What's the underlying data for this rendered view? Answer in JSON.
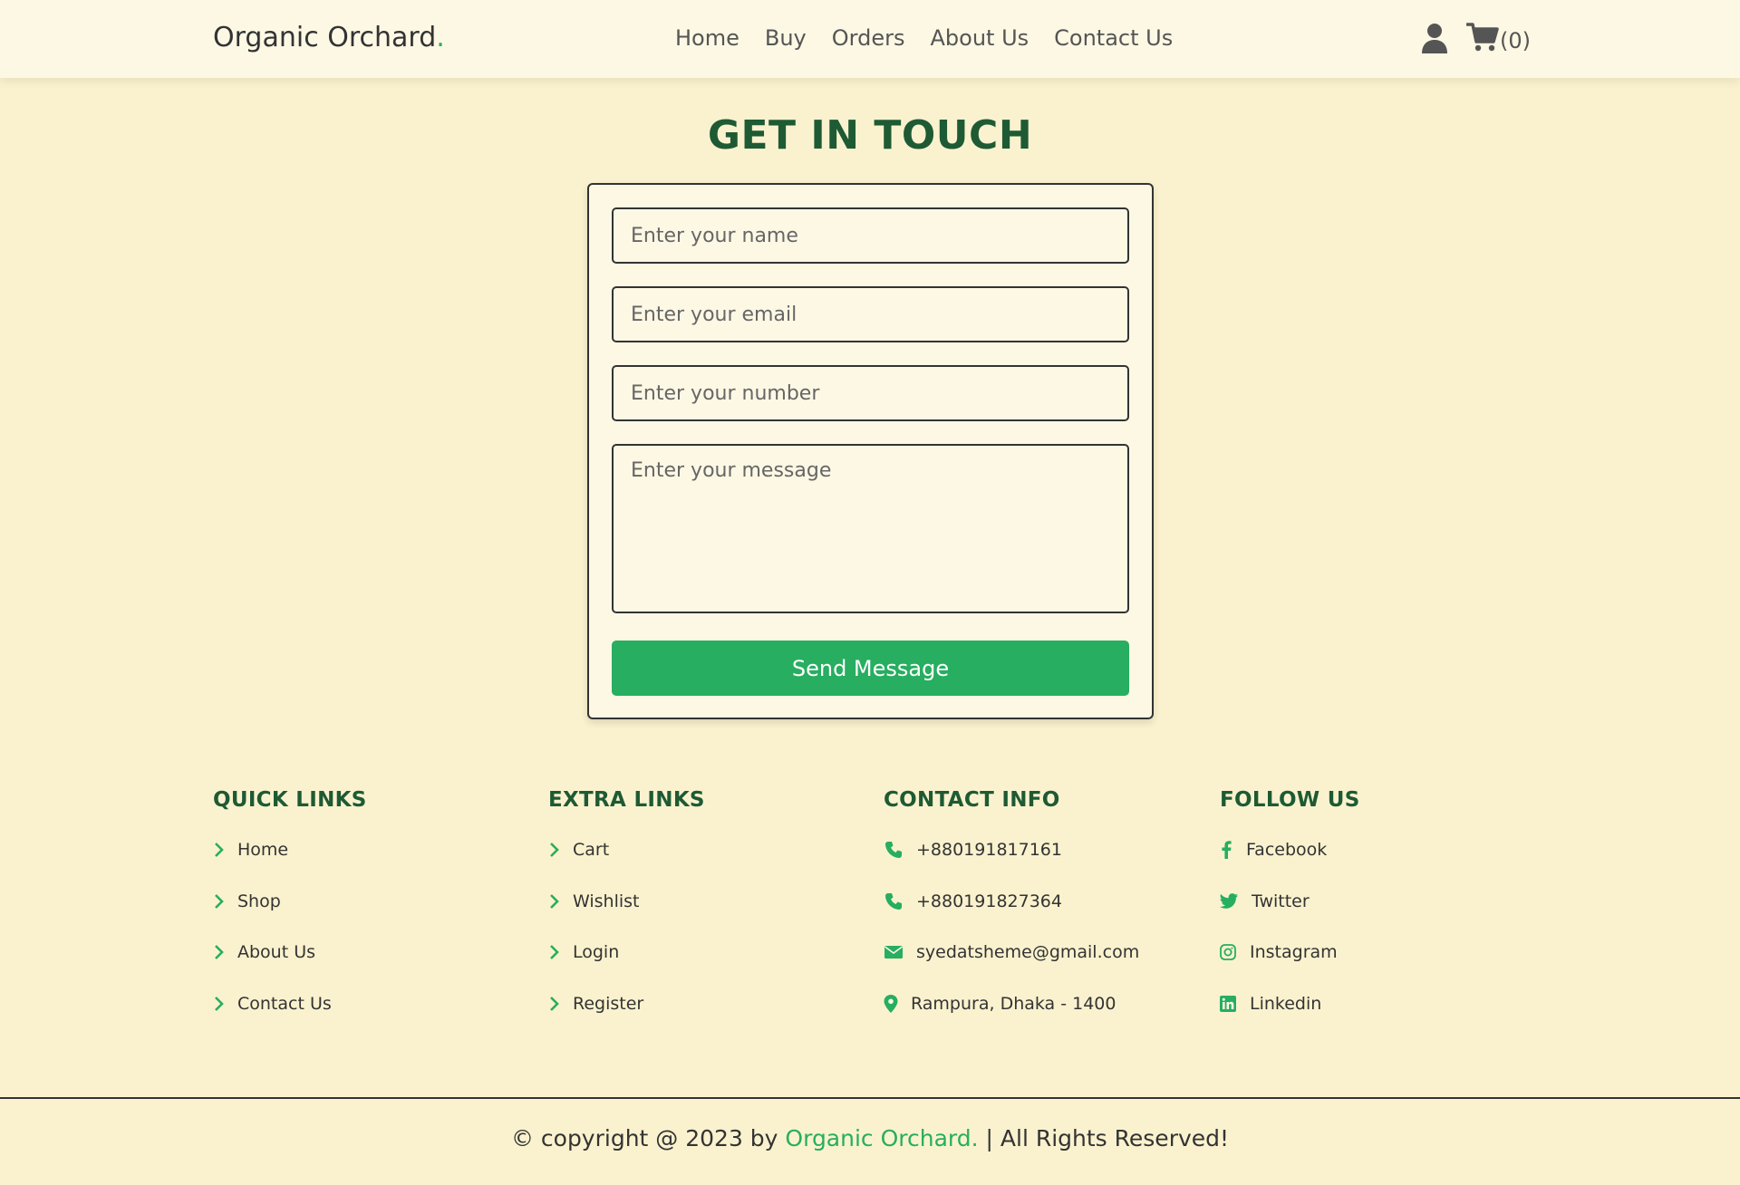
{
  "header": {
    "logo": "Organic Orchard",
    "logo_dot": ".",
    "nav": [
      "Home",
      "Buy",
      "Orders",
      "About Us",
      "Contact Us"
    ],
    "user_icon": "user-icon",
    "cart_icon": "cart-icon",
    "cart_count": "(0)"
  },
  "form": {
    "title": "GET IN TOUCH",
    "name_placeholder": "Enter your name",
    "email_placeholder": "Enter your email",
    "number_placeholder": "Enter your number",
    "message_placeholder": "Enter your message",
    "submit_label": "Send Message"
  },
  "footer": {
    "quick_links": {
      "title": "QUICK LINKS",
      "items": [
        "Home",
        "Shop",
        "About Us",
        "Contact Us"
      ]
    },
    "extra_links": {
      "title": "EXTRA LINKS",
      "items": [
        "Cart",
        "Wishlist",
        "Login",
        "Register"
      ]
    },
    "contact_info": {
      "title": "CONTACT INFO",
      "items": [
        {
          "icon": "phone-icon",
          "text": "+880191817161"
        },
        {
          "icon": "phone-icon",
          "text": "+880191827364"
        },
        {
          "icon": "envelope-icon",
          "text": "syedatsheme@gmail.com"
        },
        {
          "icon": "map-pin-icon",
          "text": "Rampura, Dhaka - 1400"
        }
      ]
    },
    "follow_us": {
      "title": "FOLLOW US",
      "items": [
        {
          "icon": "facebook-icon",
          "text": "Facebook"
        },
        {
          "icon": "twitter-icon",
          "text": "Twitter"
        },
        {
          "icon": "instagram-icon",
          "text": "Instagram"
        },
        {
          "icon": "linkedin-icon",
          "text": "Linkedin"
        }
      ]
    },
    "credit": {
      "prefix": "© copyright @ 2023 by ",
      "brand": "Organic Orchard.",
      "suffix": " | All Rights Reserved!"
    }
  },
  "colors": {
    "accent": "#27ae60",
    "heading": "#1e5a34",
    "background": "#faf2ce",
    "header_bg": "#fdf8e4"
  }
}
